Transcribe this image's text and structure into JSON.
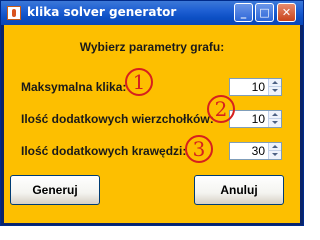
{
  "window": {
    "title": "klika solver generator",
    "controls": {
      "minimize": "_",
      "maximize": "□",
      "close": "✕"
    }
  },
  "dialog": {
    "heading": "Wybierz parametry grafu:",
    "rows": [
      {
        "label": "Maksymalna klika:",
        "value": "10",
        "annotation": "1"
      },
      {
        "label": "Ilość dodatkowych wierzchołków:",
        "value": "10",
        "annotation": "2"
      },
      {
        "label": "Ilość dodatkowych krawędzi:",
        "value": "30",
        "annotation": "3"
      }
    ],
    "buttons": {
      "generate": "Generuj",
      "cancel": "Anuluj"
    }
  },
  "colors": {
    "background": "#fdbf00",
    "titlebar": "#0c4fc4",
    "annotation": "#d6201e"
  }
}
